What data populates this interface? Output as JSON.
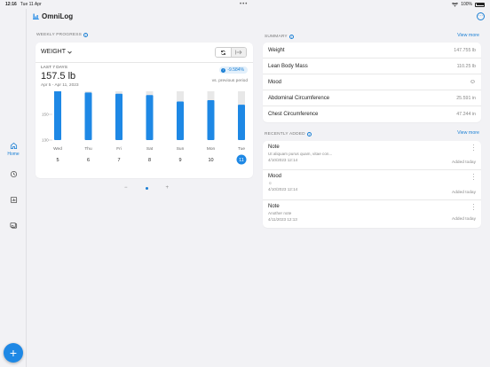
{
  "status": {
    "time": "12:16",
    "date": "Tue 11 Apr",
    "battery": "100%"
  },
  "app": {
    "title": "OmniLog",
    "accent": "#1e88e5"
  },
  "nav": {
    "home_label": "Home"
  },
  "progress": {
    "section_label": "WEEKLY PROGRESS",
    "metric": "WEIGHT",
    "period_label": "LAST 7 DAYS",
    "value": "157.5 lb",
    "date_range": "Apr 5 - Apr 11, 2023",
    "change": "-9.584%",
    "change_caption": "vs. previous period"
  },
  "chart_data": {
    "type": "bar",
    "categories": [
      "Wed",
      "Thu",
      "Fri",
      "Sat",
      "Sun",
      "Mon",
      "Tue"
    ],
    "day_numbers": [
      "5",
      "6",
      "7",
      "8",
      "9",
      "10",
      "11"
    ],
    "selected_index": 6,
    "values": [
      169,
      167,
      166,
      165,
      160,
      161,
      157.5
    ],
    "y_ticks": [
      "170",
      "150",
      "130"
    ],
    "ylim": [
      130,
      170
    ],
    "bar_color": "#1e88e5",
    "track_color": "#e8e8e8"
  },
  "pager": {
    "prev": "−",
    "next": "+"
  },
  "summary": {
    "section_label": "SUMMARY",
    "view_more": "View more",
    "rows": [
      {
        "label": "Weight",
        "value": "147.755 lb"
      },
      {
        "label": "Lean Body Mass",
        "value": "110.25 lb"
      },
      {
        "label": "Mood",
        "value": "☺"
      },
      {
        "label": "Abdominal Circumference",
        "value": "25.591 in"
      },
      {
        "label": "Chest Circumference",
        "value": "47.244 in"
      }
    ]
  },
  "recent": {
    "section_label": "RECENTLY ADDED",
    "view_more": "View more",
    "entries": [
      {
        "title": "Note",
        "desc": "Ut aliquam purus quam, vitae con...",
        "timestamp": "4/10/2023 12:14",
        "added": "Added today"
      },
      {
        "title": "Mood",
        "desc": "☺",
        "timestamp": "4/10/2023 12:14",
        "added": "Added today"
      },
      {
        "title": "Note",
        "desc": "Another note",
        "timestamp": "4/11/2023 12:13",
        "added": "Added today"
      }
    ]
  }
}
